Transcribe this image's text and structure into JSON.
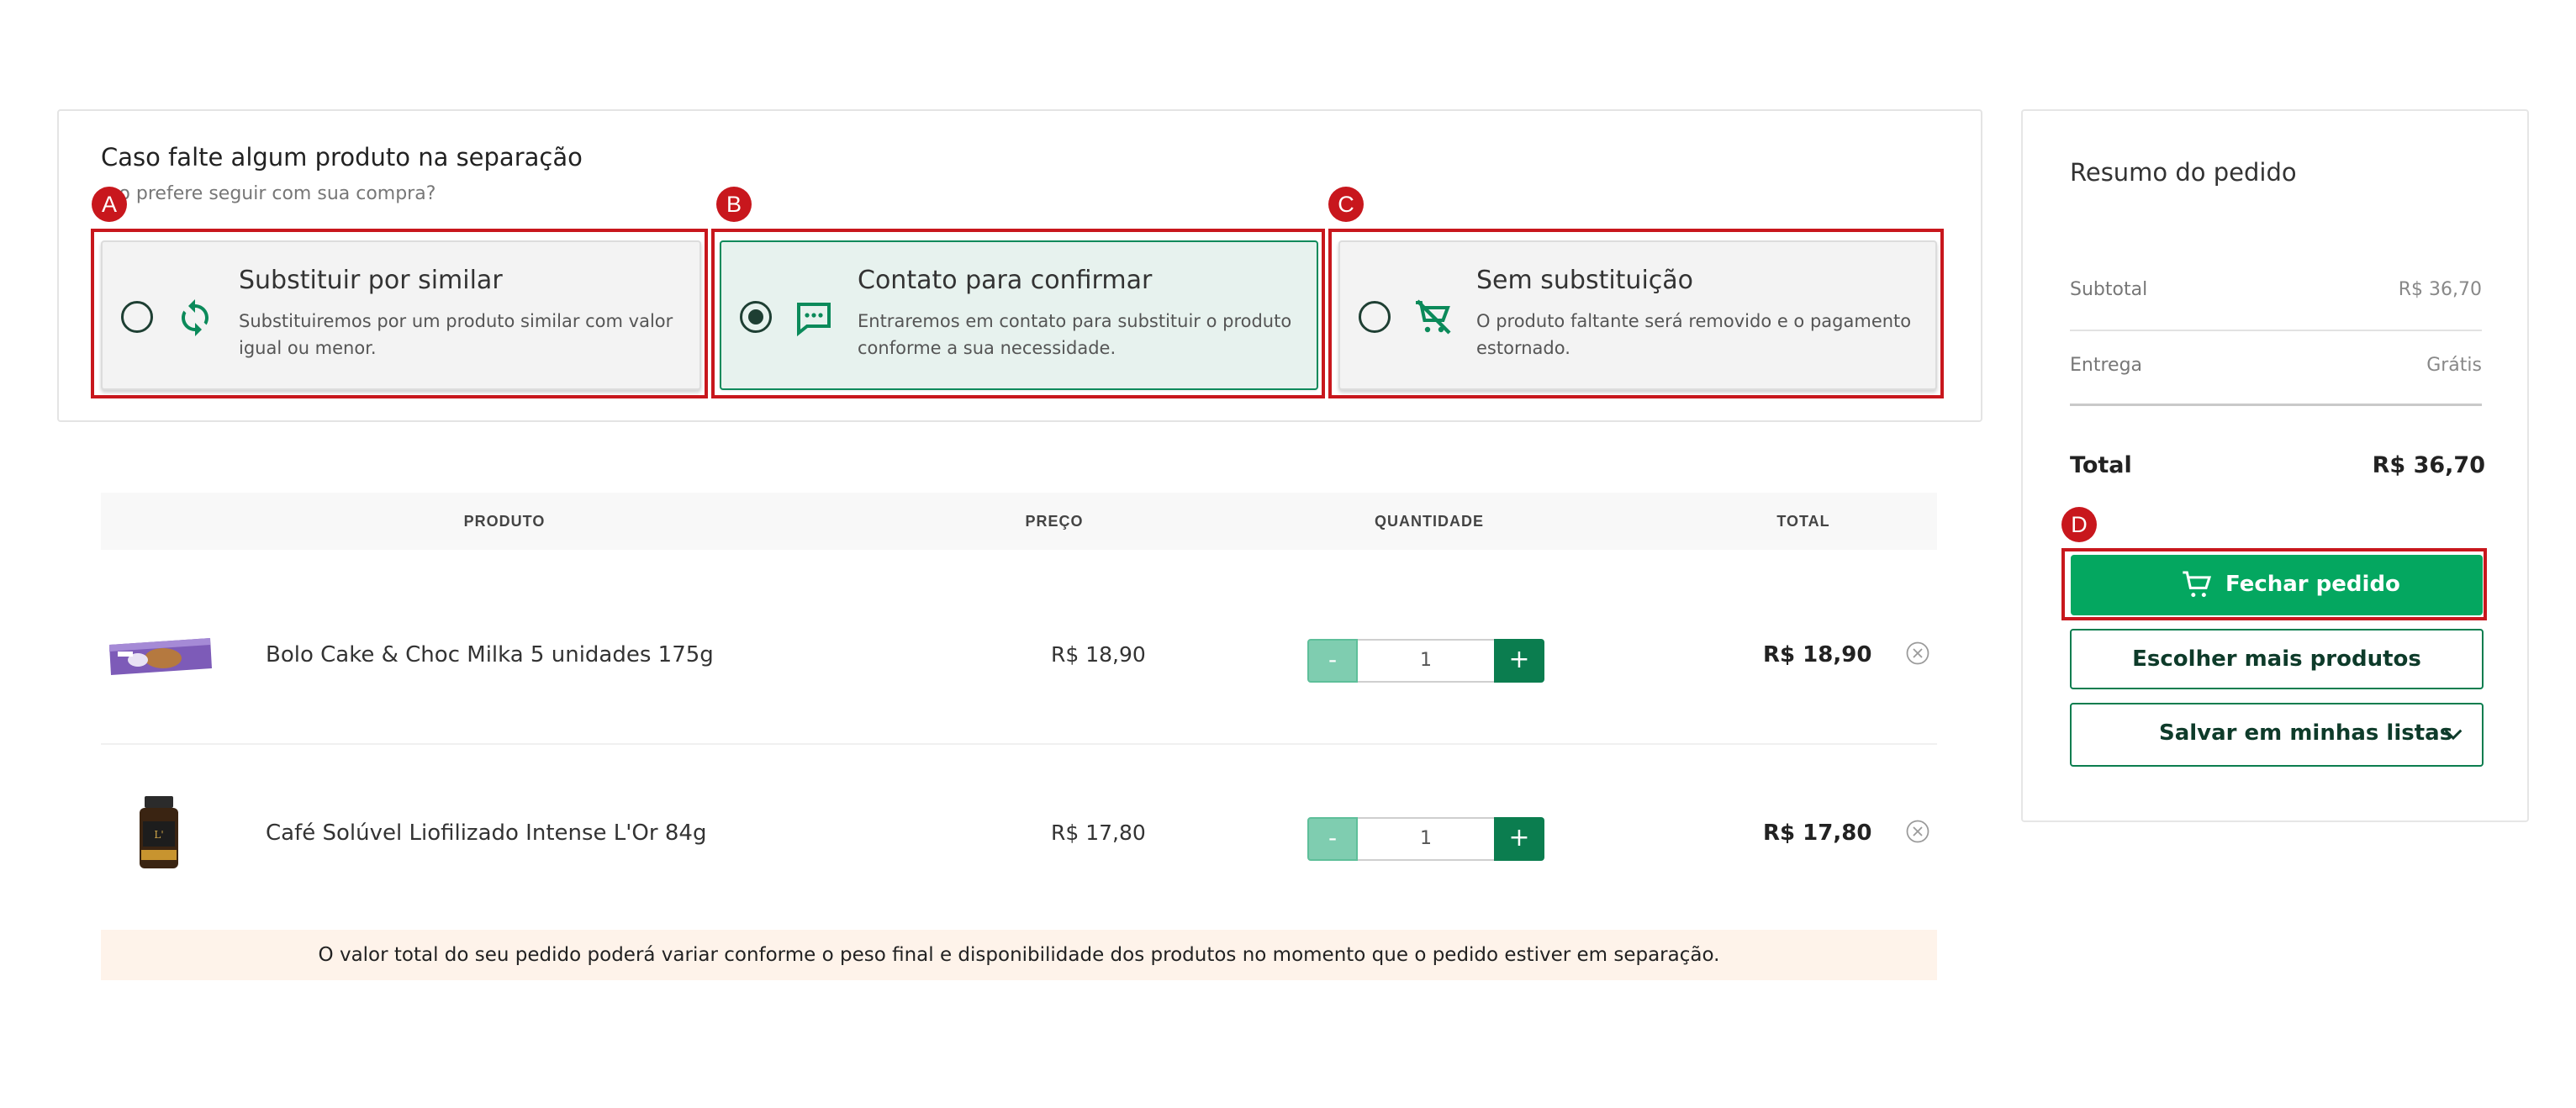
{
  "substitution": {
    "title": "Caso falte algum produto na separação",
    "subtitle": "mo prefere seguir com sua compra?",
    "options": [
      {
        "badge": "A",
        "title": "Substituir por similar",
        "description": "Substituiremos por um produto similar com valor igual ou menor.",
        "icon": "refresh-icon",
        "selected": false
      },
      {
        "badge": "B",
        "title": "Contato para confirmar",
        "description": "Entraremos em contato para substituir o produto conforme a sua necessidade.",
        "icon": "chat-icon",
        "selected": true
      },
      {
        "badge": "C",
        "title": "Sem substituição",
        "description": "O produto faltante será removido e o pagamento estornado.",
        "icon": "cart-off-icon",
        "selected": false
      }
    ]
  },
  "table": {
    "headers": {
      "product": "PRODUTO",
      "price": "PREÇO",
      "quantity": "QUANTIDADE",
      "total": "TOTAL"
    },
    "rows": [
      {
        "name": "Bolo Cake & Choc Milka 5 unidades 175g",
        "price": "R$ 18,90",
        "qty": "1",
        "total": "R$ 18,90",
        "minus": "-",
        "plus": "+"
      },
      {
        "name": "Café Solúvel Liofilizado Intense L'Or 84g",
        "price": "R$ 17,80",
        "qty": "1",
        "total": "R$ 17,80",
        "minus": "-",
        "plus": "+"
      }
    ]
  },
  "notice": "O valor total do seu pedido poderá variar conforme o peso final e disponibilidade dos produtos no momento que o pedido estiver em separação.",
  "summary": {
    "title": "Resumo do pedido",
    "subtotal_label": "Subtotal",
    "subtotal_value": "R$ 36,70",
    "delivery_label": "Entrega",
    "delivery_value": "Grátis",
    "total_label": "Total",
    "total_value": "R$ 36,70",
    "badge": "D",
    "checkout_label": "Fechar pedido",
    "more_products_label": "Escolher mais produtos",
    "save_lists_label": "Salvar em minhas listas"
  },
  "colors": {
    "accent_green": "#04a760",
    "dark_green": "#0b7d4f",
    "annotation_red": "#c8171d",
    "notice_bg": "#fef3ea"
  }
}
